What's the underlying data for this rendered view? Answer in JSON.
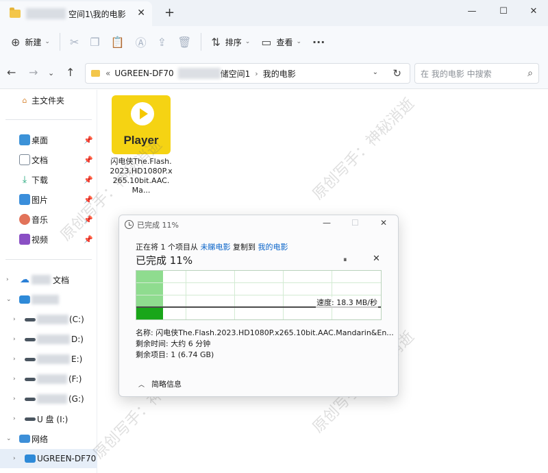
{
  "tab": {
    "title": "空间1\\我的电影"
  },
  "toolbar": {
    "new_label": "新建",
    "sort_label": "排序",
    "view_label": "查看",
    "more_label": "···"
  },
  "address": {
    "seg1": "UGREEN-DF70",
    "seg2": "储空间1",
    "seg3": "我的电影",
    "overflow": "«"
  },
  "search": {
    "placeholder": "在 我的电影 中搜索"
  },
  "sidebar": {
    "home": "主文件夹",
    "desktop": "桌面",
    "documents": "文档",
    "downloads": "下载",
    "pictures": "图片",
    "music": "音乐",
    "videos": "视频",
    "cloud_docs": "文档",
    "drive_c": "(C:)",
    "drive_d": "D:)",
    "drive_e": "E:)",
    "drive_f": "(F:)",
    "drive_g": "(G:)",
    "drive_u": "U 盘 (I:)",
    "network": "网络",
    "nas": "UGREEN-DF70"
  },
  "file": {
    "thumb_label": "Player",
    "name": "闪电侠The.Flash.2023.HD1080P.x265.10bit.AAC.Ma..."
  },
  "dialog": {
    "title": "已完成 11%",
    "copy_prefix": "正在将 1 个项目从",
    "source": "未睇电影",
    "copy_mid": "复制到",
    "dest": "我的电影",
    "heading": "已完成 11%",
    "progress_fraction": 0.11,
    "speed": "速度: 18.3 MB/秒",
    "name_line": "名称: 闪电侠The.Flash.2023.HD1080P.x265.10bit.AAC.Mandarin&En...",
    "time_left": "剩余时间: 大约 6 分钟",
    "items_left": "剩余项目: 1 (6.74 GB)",
    "less_details": "简略信息"
  },
  "watermark": {
    "text": "原创写手：神秘消逝"
  },
  "colors": {
    "accent": "#0a64c9",
    "progress_fill": "#8fdc8f",
    "progress_area": "#19a619",
    "thumb_bg": "#f5d313",
    "folder": "#f3c64a"
  }
}
